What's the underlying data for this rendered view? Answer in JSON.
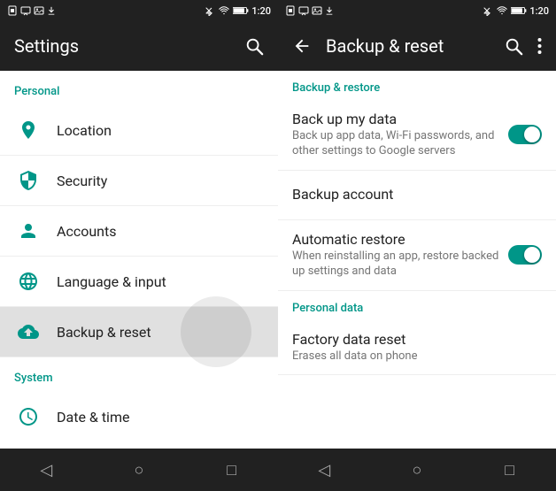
{
  "left": {
    "status_bar": {
      "time": "1:20",
      "icons_left": [
        "sim",
        "wifi",
        "messages",
        "download",
        "photos"
      ]
    },
    "app_bar": {
      "title": "Settings",
      "search_label": "search"
    },
    "sections": [
      {
        "label": "Personal",
        "items": [
          {
            "id": "location",
            "icon": "location-icon",
            "text": "Location"
          },
          {
            "id": "security",
            "icon": "security-icon",
            "text": "Security"
          },
          {
            "id": "accounts",
            "icon": "accounts-icon",
            "text": "Accounts"
          },
          {
            "id": "language",
            "icon": "language-icon",
            "text": "Language & input"
          },
          {
            "id": "backup",
            "icon": "backup-icon",
            "text": "Backup & reset",
            "active": true
          }
        ]
      },
      {
        "label": "System",
        "items": [
          {
            "id": "datetime",
            "icon": "datetime-icon",
            "text": "Date & time"
          }
        ]
      }
    ]
  },
  "right": {
    "status_bar": {
      "time": "1:20"
    },
    "app_bar": {
      "title": "Backup & reset",
      "back_label": "back",
      "search_label": "search",
      "more_label": "more"
    },
    "sections": [
      {
        "label": "Backup & restore",
        "items": [
          {
            "id": "backup-data",
            "title": "Back up my data",
            "subtitle": "Back up app data, Wi-Fi passwords, and other settings to Google servers",
            "toggle": true,
            "toggle_on": true
          },
          {
            "id": "backup-account",
            "title": "Backup account",
            "subtitle": null,
            "toggle": false
          },
          {
            "id": "auto-restore",
            "title": "Automatic restore",
            "subtitle": "When reinstalling an app, restore backed up settings and data",
            "toggle": true,
            "toggle_on": true
          }
        ]
      },
      {
        "label": "Personal data",
        "items": [
          {
            "id": "factory-reset",
            "title": "Factory data reset",
            "subtitle": "Erases all data on phone",
            "toggle": false
          }
        ]
      }
    ],
    "nav_bar": {
      "back": "◁",
      "home": "○",
      "recents": "□"
    }
  },
  "nav_bar": {
    "back": "◁",
    "home": "○",
    "recents": "□"
  }
}
